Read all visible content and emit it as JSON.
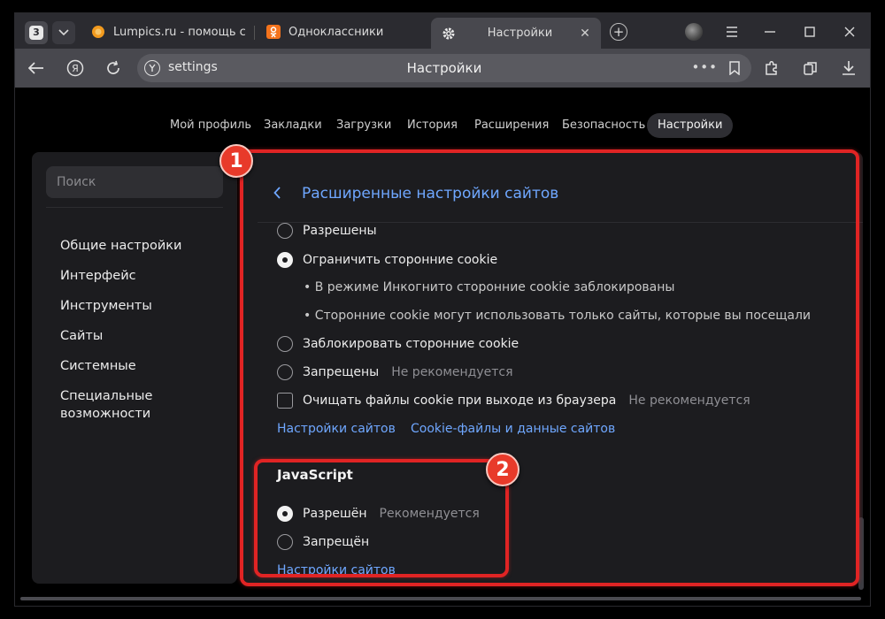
{
  "browser": {
    "tab_count": "3",
    "tabs": [
      {
        "title": "Lumpics.ru - помощь с ко"
      },
      {
        "title": "Одноклассники"
      },
      {
        "title": "Настройки"
      }
    ],
    "address": {
      "url": "settings",
      "page_title": "Настройки"
    }
  },
  "nav": {
    "items": [
      "Мой профиль",
      "Закладки",
      "Загрузки",
      "История",
      "Расширения",
      "Безопасность",
      "Настройки"
    ],
    "active": "Настройки"
  },
  "sidebar": {
    "search_placeholder": "Поиск",
    "items": [
      "Общие настройки",
      "Интерфейс",
      "Инструменты",
      "Сайты",
      "Системные",
      "Специальные возможности"
    ]
  },
  "content": {
    "title": "Расширенные настройки сайтов",
    "cookies": {
      "allowed": "Разрешены",
      "limit_third_party": "Ограничить сторонние cookie",
      "note_incognito": "• В режиме Инкогнито сторонние cookie заблокированы",
      "note_visited": "• Сторонние cookie могут использовать только сайты, которые вы посещали",
      "block_third_party": "Заблокировать сторонние cookie",
      "denied": "Запрещены",
      "denied_hint": "Не рекомендуется",
      "clear_on_exit": "Очищать файлы cookie при выходе из браузера",
      "clear_on_exit_hint": "Не рекомендуется",
      "link_site_settings": "Настройки сайтов",
      "link_cookie_data": "Cookie-файлы и данные сайтов"
    },
    "javascript": {
      "heading": "JavaScript",
      "allowed": "Разрешён",
      "allowed_hint": "Рекомендуется",
      "denied": "Запрещён",
      "link_site_settings": "Настройки сайтов"
    }
  },
  "annotations": {
    "badge_1": "1",
    "badge_2": "2",
    "color": "#e02424"
  }
}
